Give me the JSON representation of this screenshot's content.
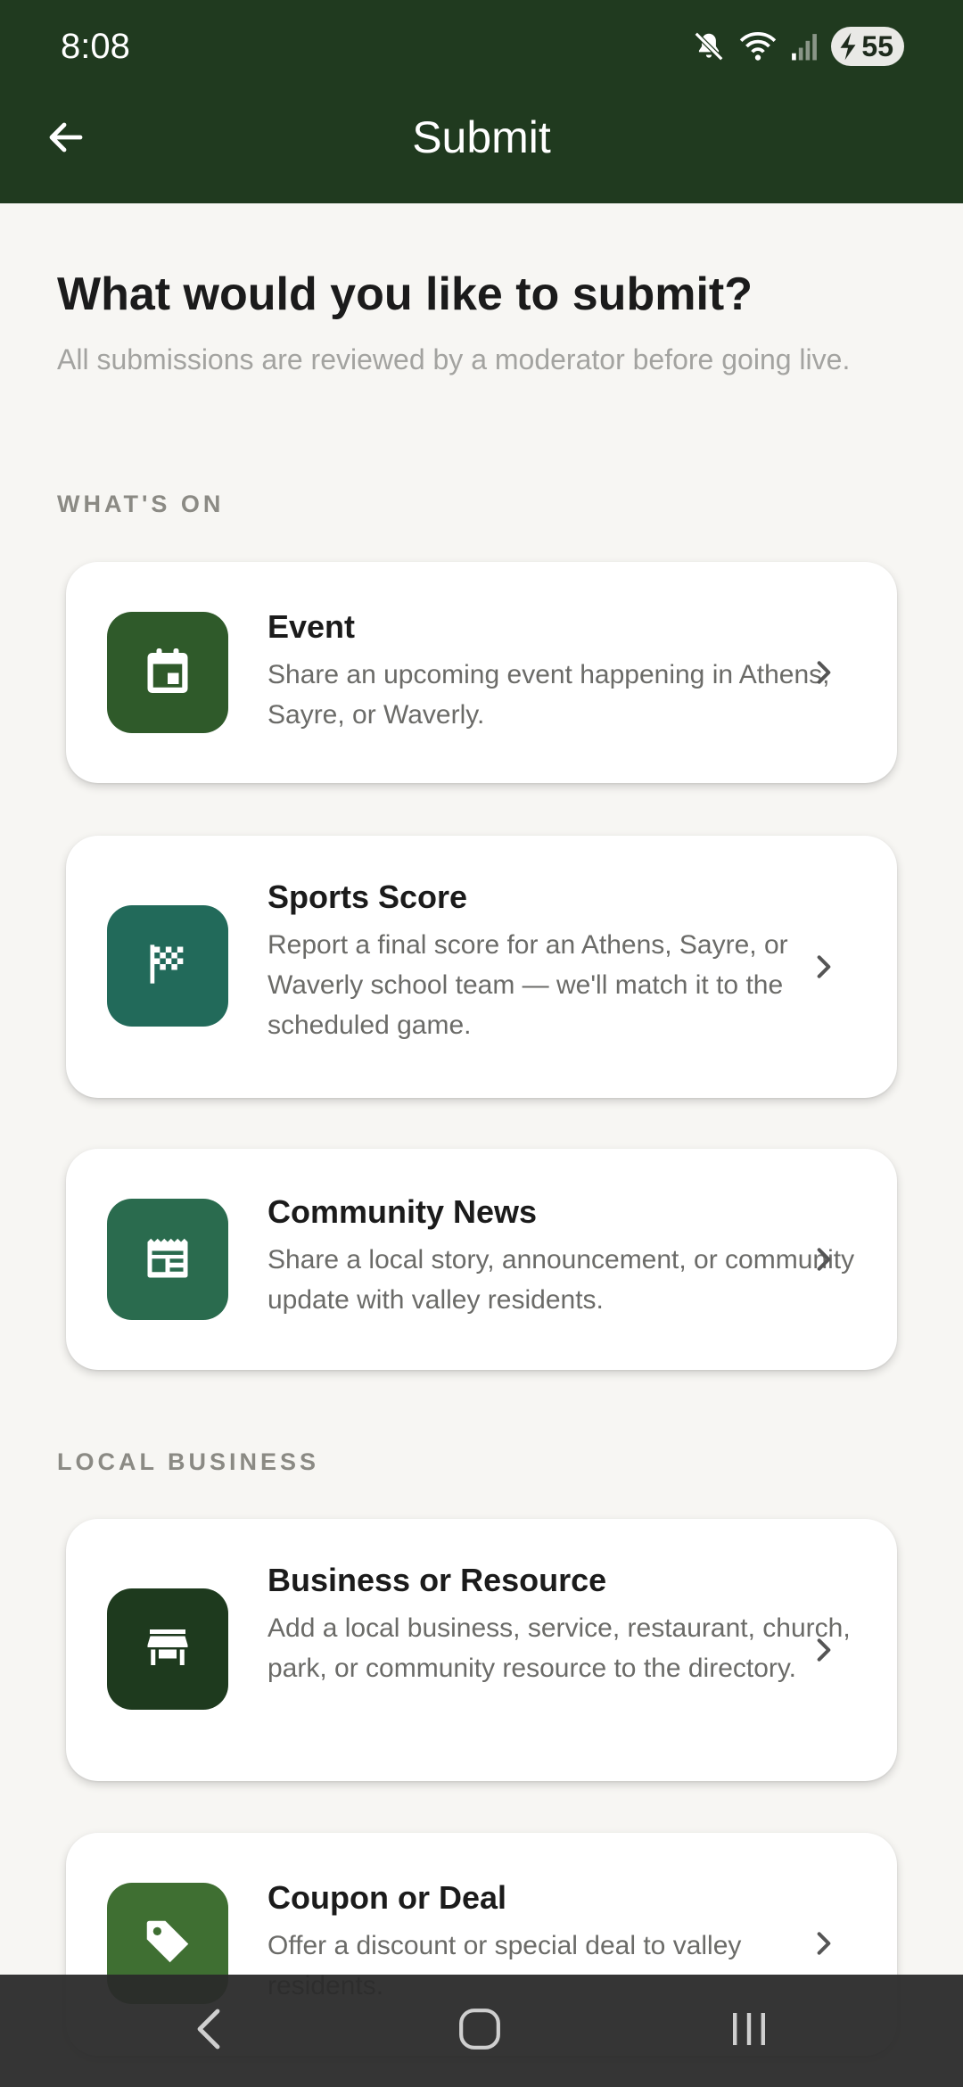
{
  "status_bar": {
    "time": "8:08",
    "battery_level": "55",
    "icons": [
      "mute-icon",
      "wifi-icon",
      "signal-icon",
      "battery-charging-icon"
    ]
  },
  "header": {
    "title": "Submit",
    "back_icon": "arrow-left-icon"
  },
  "page": {
    "title": "What would you like to submit?",
    "subtitle": "All submissions are reviewed by a moderator before going live."
  },
  "sections": {
    "whats_on": "WHAT'S ON",
    "local_business": "LOCAL BUSINESS"
  },
  "cards": [
    {
      "title": "Event",
      "description": "Share an upcoming event happening in Athens, Sayre, or Waverly.",
      "icon": "calendar-icon",
      "color": "#2f5a2a"
    },
    {
      "title": "Sports Score",
      "description": "Report a final score for an Athens, Sayre, or Waverly school team — we'll match it to the scheduled game.",
      "icon": "checkered-flag-icon",
      "color": "#226a5a"
    },
    {
      "title": "Community News",
      "description": "Share a local story, announcement, or community update with valley residents.",
      "icon": "newspaper-icon",
      "color": "#2a6b4e"
    },
    {
      "title": "Business or Resource",
      "description": "Add a local business, service, restaurant, church, park, or community resource to the directory.",
      "icon": "storefront-icon",
      "color": "#1e3a1e"
    },
    {
      "title": "Coupon or Deal",
      "description": "Offer a discount or special deal to valley residents.",
      "icon": "tag-icon",
      "color": "#3f6f32"
    }
  ],
  "colors": {
    "header_bg": "#203a1f",
    "page_bg": "#f7f6f3",
    "section_label": "#8b8a84"
  },
  "nav_bar": {
    "buttons": [
      "back-nav-icon",
      "home-nav-icon",
      "recents-nav-icon"
    ]
  }
}
